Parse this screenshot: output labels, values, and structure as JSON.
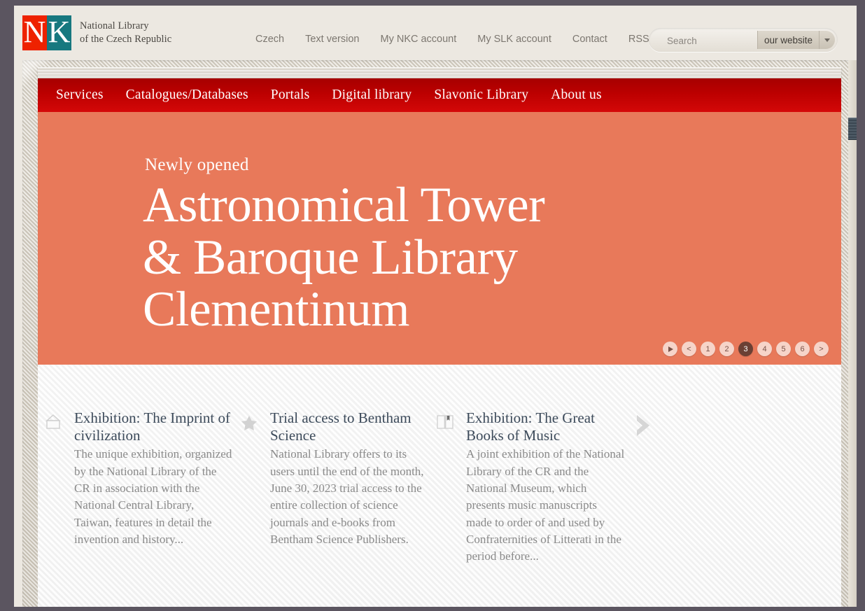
{
  "header": {
    "logo": {
      "mark_letters": [
        "N",
        "K"
      ],
      "colors": {
        "red": "#ee2200",
        "teal": "#17787f"
      },
      "title_line1": "National Library",
      "title_line2": "of the Czech Republic"
    },
    "utility_nav": [
      {
        "label": "Czech"
      },
      {
        "label": "Text version"
      },
      {
        "label": "My NKC account"
      },
      {
        "label": "My SLK account"
      },
      {
        "label": "Contact"
      },
      {
        "label": "RSS"
      }
    ],
    "search": {
      "placeholder": "Search",
      "value": "",
      "scope_label": "our website",
      "caret_icon": "chevron-down-icon"
    }
  },
  "main_nav": {
    "background_from": "#a60000",
    "background_to": "#d40808",
    "items": [
      {
        "label": "Services"
      },
      {
        "label": "Catalogues/Databases"
      },
      {
        "label": "Portals"
      },
      {
        "label": "Digital library"
      },
      {
        "label": "Slavonic Library"
      },
      {
        "label": "About us"
      }
    ]
  },
  "hero": {
    "background_color": "#e8795a",
    "eyebrow": "Newly opened",
    "title": "Astronomical Tower\n& Baroque Library\nClementinum",
    "carousel": {
      "play_icon": "play-icon",
      "prev_label": "<",
      "next_label": ">",
      "pages": [
        "1",
        "2",
        "3",
        "4",
        "5",
        "6"
      ],
      "active_page": "3",
      "active_color": "#6b4034",
      "inactive_color": "#f6d4c9"
    }
  },
  "news": {
    "next_arrow_icon": "chevron-right-icon",
    "cards": [
      {
        "icon": "picture-frame-icon",
        "title": "Exhibition: The Imprint of civilization",
        "text": "The unique exhibition, organized by the National Library of the CR in association with the National Central Library, Taiwan, features in detail the invention and history..."
      },
      {
        "icon": "star-icon",
        "title": "Trial access to Bentham Science",
        "text": "National Library offers to its users until the end of the month, June 30, 2023 trial access to the entire collection of science journals and e-books from Bentham Science Publishers."
      },
      {
        "icon": "open-book-icon",
        "title": "Exhibition: The Great Books of Music",
        "text": "A joint exhibition of the National Library of the CR and the National Museum, which presents music manuscripts made to order of and used by Confraternities of Litterati in the period before..."
      }
    ]
  },
  "scrollbar": {
    "thumb_color": "#3c4853"
  }
}
